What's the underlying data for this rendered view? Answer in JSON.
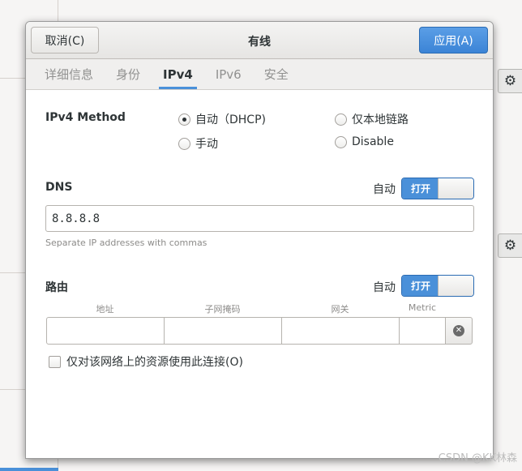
{
  "dialog": {
    "title": "有线",
    "cancel_label": "取消(C)",
    "apply_label": "应用(A)"
  },
  "tabs": [
    {
      "label": "详细信息",
      "active": false
    },
    {
      "label": "身份",
      "active": false
    },
    {
      "label": "IPv4",
      "active": true
    },
    {
      "label": "IPv6",
      "active": false
    },
    {
      "label": "安全",
      "active": false
    }
  ],
  "ipv4": {
    "method_label": "IPv4 Method",
    "options": [
      {
        "label": "自动（DHCP)",
        "checked": true
      },
      {
        "label": "仅本地链路",
        "checked": false
      },
      {
        "label": "手动",
        "checked": false
      },
      {
        "label": "Disable",
        "checked": false
      }
    ]
  },
  "dns": {
    "label": "DNS",
    "auto_label": "自动",
    "switch_label": "打开",
    "switch_on": true,
    "value": "8.8.8.8",
    "hint": "Separate IP addresses with commas"
  },
  "routes": {
    "label": "路由",
    "auto_label": "自动",
    "switch_label": "打开",
    "switch_on": true,
    "columns": [
      "地址",
      "子网掩码",
      "网关",
      "Metric"
    ]
  },
  "restrict": {
    "label": "仅对该网络上的资源使用此连接(O)",
    "checked": false
  },
  "background": {
    "gear_icon": "gear-icon"
  },
  "watermark": "CSDN @KK林森"
}
